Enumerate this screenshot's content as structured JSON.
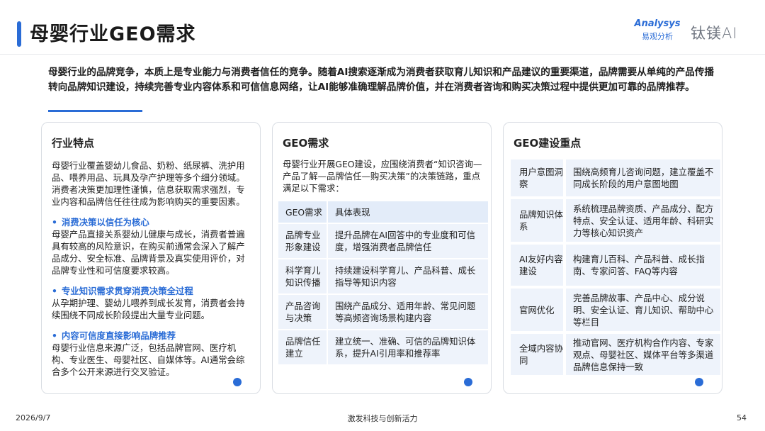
{
  "header": {
    "title": "母婴行业GEO需求",
    "logo_analysys_en": "Analysys",
    "logo_analysys_cn": "易观分析",
    "logo_tai": "钛镁AI"
  },
  "intro": "母婴行业的品牌竞争，本质上是专业能力与消费者信任的竞争。随着AI搜索逐渐成为消费者获取育儿知识和产品建议的重要渠道，品牌需要从单纯的产品传播转向品牌知识建设，持续完善专业内容体系和可信信息网络，让AI能够准确理解品牌价值，并在消费者咨询和购买决策过程中提供更加可靠的品牌推荐。",
  "card1": {
    "title": "行业特点",
    "paragraph": "母婴行业覆盖婴幼儿食品、奶粉、纸尿裤、洗护用品、喂养用品、玩具及孕产护理等多个细分领域。消费者决策更加理性谨慎，信息获取需求强烈，专业内容和品牌信任往往成为影响购买的重要因素。",
    "bullets": [
      {
        "head": "消费决策以信任为核心",
        "text": "母婴产品直接关系婴幼儿健康与成长，消费者普遍具有较高的风险意识，在购买前通常会深入了解产品成分、安全标准、品牌背景及真实使用评价，对品牌专业性和可信度要求较高。"
      },
      {
        "head": "专业知识需求贯穿消费决策全过程",
        "text": "从孕期护理、婴幼儿喂养到成长发育，消费者会持续围绕不同成长阶段提出大量专业问题。"
      },
      {
        "head": "内容可信度直接影响品牌推荐",
        "text": "母婴行业信息来源广泛，包括品牌官网、医疗机构、专业医生、母婴社区、自媒体等。AI通常会综合多个公开来源进行交叉验证。"
      }
    ]
  },
  "card2": {
    "title": "GEO需求",
    "intro": "母婴行业开展GEO建设，应围绕消费者“知识咨询—产品了解—品牌信任—购买决策”的决策链路，重点满足以下需求：",
    "table_headers": [
      "GEO需求",
      "具体表现"
    ],
    "rows": [
      {
        "need": "品牌专业形象建设",
        "detail": "提升品牌在AI回答中的专业度和可信度，增强消费者品牌信任"
      },
      {
        "need": "科学育儿知识传播",
        "detail": "持续建设科学育儿、产品科普、成长指导等知识内容"
      },
      {
        "need": "产品咨询与决策",
        "detail": "围绕产品成分、适用年龄、常见问题等高频咨询场景构建内容"
      },
      {
        "need": "品牌信任建立",
        "detail": "建立统一、准确、可信的品牌知识体系，提升AI引用率和推荐率"
      }
    ]
  },
  "card3": {
    "title": "GEO建设重点",
    "rows": [
      {
        "key": "用户意图洞察",
        "value": "围绕高频育儿咨询问题，建立覆盖不同成长阶段的用户意图地图"
      },
      {
        "key": "品牌知识体系",
        "value": "系统梳理品牌资质、产品成分、配方特点、安全认证、适用年龄、科研实力等核心知识资产"
      },
      {
        "key": "AI友好内容建设",
        "value": "构建育儿百科、产品科普、成长指南、专家问答、FAQ等内容"
      },
      {
        "key": "官网优化",
        "value": "完善品牌故事、产品中心、成分说明、安全认证、育儿知识、帮助中心等栏目"
      },
      {
        "key": "全域内容协同",
        "value": "推动官网、医疗机构合作内容、专家观点、母婴社区、媒体平台等多渠道品牌信息保持一致"
      }
    ]
  },
  "footer": {
    "date": "2026/9/7",
    "slogan": "激发科技与创新活力",
    "page": "54"
  },
  "colors": {
    "accent": "#2a6cd6",
    "table_bg": "#eef3fb",
    "table_head_bg": "#e3ecf9"
  }
}
